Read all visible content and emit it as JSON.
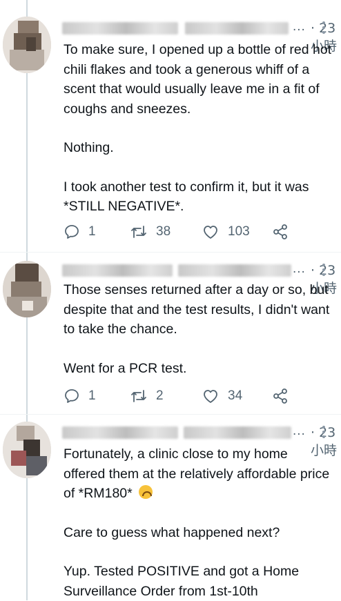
{
  "tweets": [
    {
      "ellipsis": "...",
      "time": "· 23 小時",
      "more": "⋮",
      "paragraphs": [
        "To make sure, I opened up a bottle of red hot chili flakes and took a generous whiff of a scent that would usually leave me in a fit of coughs and sneezes.",
        "Nothing.",
        "I took another test to confirm it, but it was *STILL NEGATIVE*."
      ],
      "reply_count": "1",
      "retweet_count": "38",
      "like_count": "103"
    },
    {
      "ellipsis": "...",
      "time": "· 23 小時",
      "more": "⋮",
      "paragraphs": [
        "Those senses returned after a day or so, but despite that and the test results, I didn't want to take the chance.",
        "Went for a PCR test."
      ],
      "reply_count": "1",
      "retweet_count": "2",
      "like_count": "34"
    },
    {
      "ellipsis": "...",
      "time": "· 23 小時",
      "more": "⋮",
      "paragraphs": [
        "Fortunately, a clinic close to my home offered them at the relatively affordable price of *RM180*",
        "Care to guess what happened next?",
        "Yup. Tested POSITIVE and got a Home Surveillance Order from 1st-10th"
      ],
      "emoji": "upside-down-face",
      "reply_count": "",
      "retweet_count": "",
      "like_count": ""
    }
  ],
  "colors": {
    "text": "#0f1419",
    "secondary": "#536471",
    "divider": "#eff3f4"
  },
  "icons": [
    "reply-icon",
    "retweet-icon",
    "like-icon",
    "share-icon",
    "more-icon"
  ]
}
